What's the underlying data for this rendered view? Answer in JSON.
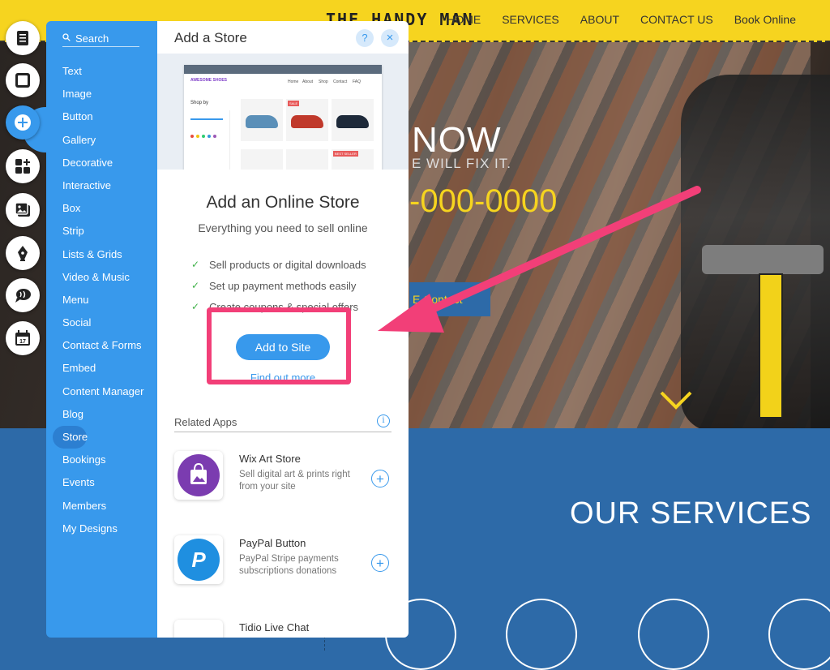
{
  "site": {
    "logo": "THE HANDY MAN",
    "nav": [
      "HOME",
      "SERVICES",
      "ABOUT",
      "CONTACT US",
      "Book Online"
    ],
    "hero_now": "NOW",
    "hero_sub": "E WILL FIX IT.",
    "hero_phone": "-000-0000",
    "hero_button": "E Contact",
    "services_title": "OUR SERVICES"
  },
  "toolbar": {
    "tools": [
      {
        "name": "menus-pages-icon"
      },
      {
        "name": "background-icon"
      },
      {
        "name": "add-icon",
        "active": true
      },
      {
        "name": "add-apps-icon"
      },
      {
        "name": "media-icon"
      },
      {
        "name": "blog-pen-icon"
      },
      {
        "name": "chat-icon"
      },
      {
        "name": "bookings-calendar-icon"
      }
    ]
  },
  "add_panel": {
    "search_label": "Search",
    "categories": [
      "Text",
      "Image",
      "Button",
      "Gallery",
      "Decorative",
      "Interactive",
      "Box",
      "Strip",
      "Lists & Grids",
      "Video & Music",
      "Menu",
      "Social",
      "Contact & Forms",
      "Embed",
      "Content Manager",
      "Blog",
      "Store",
      "Bookings",
      "Events",
      "Members",
      "My Designs"
    ],
    "selected_category": "Store",
    "title": "Add a Store",
    "help_label": "?",
    "close_label": "×",
    "preview": {
      "brand": "AWESOME SHOES",
      "nav": [
        "Home",
        "About",
        "Shop",
        "Contact",
        "FAQ"
      ],
      "shop_by": "Shop by",
      "sale_badge": "SALE",
      "best_seller_badge": "BEST SELLER"
    },
    "heading": "Add an Online Store",
    "subheading": "Everything you need to sell online",
    "features": [
      "Sell products or digital downloads",
      "Set up payment methods easily",
      "Create coupons & special offers"
    ],
    "add_button": "Add to Site",
    "find_out_more": "Find out more",
    "related_apps_label": "Related Apps",
    "related_apps": [
      {
        "name": "Wix Art Store",
        "description": "Sell digital art & prints right from your site",
        "icon": "art-store-bag-icon"
      },
      {
        "name": "PayPal Button",
        "description": "PayPal Stripe payments subscriptions donations",
        "icon": "paypal-icon"
      },
      {
        "name": "Tidio Live Chat",
        "description": "",
        "icon": "tidio-chat-icon"
      }
    ]
  },
  "colors": {
    "accent": "#3899ec",
    "site_yellow": "#f6d41f",
    "site_blue": "#2d6aa8",
    "annotation": "#f23f78"
  }
}
